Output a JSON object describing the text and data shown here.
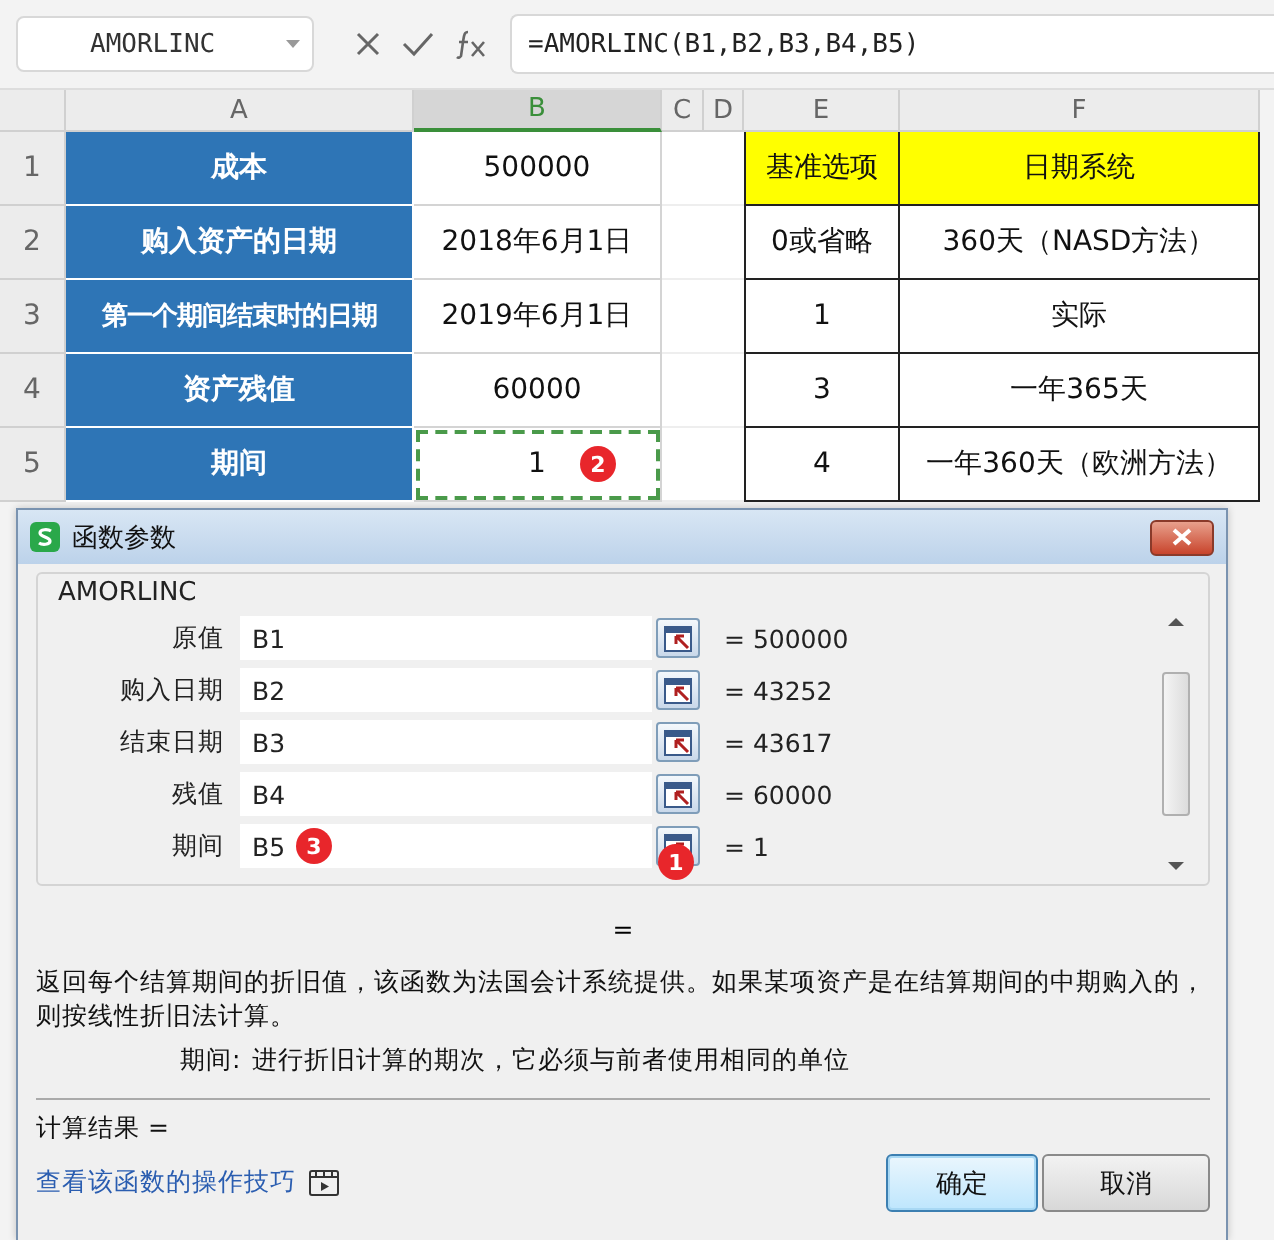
{
  "formula_bar": {
    "name_box": "AMORLINC",
    "formula": "=AMORLINC(B1,B2,B3,B4,B5)"
  },
  "columns": [
    {
      "label": "A",
      "selected": false
    },
    {
      "label": "B",
      "selected": true
    },
    {
      "label": "C",
      "selected": false
    },
    {
      "label": "D",
      "selected": false
    },
    {
      "label": "E",
      "selected": false
    },
    {
      "label": "F",
      "selected": false
    }
  ],
  "rows": [
    {
      "number": "1",
      "cells": [
        {
          "kind": "label",
          "text": "成本",
          "selected": false
        },
        {
          "kind": "value",
          "text": "500000",
          "selected": false
        },
        {
          "kind": "empty"
        },
        {
          "kind": "empty"
        },
        {
          "kind": "header",
          "text": "基准选项",
          "selected": false
        },
        {
          "kind": "header",
          "text": "日期系统",
          "selected": false
        }
      ]
    },
    {
      "number": "2",
      "cells": [
        {
          "kind": "label",
          "text": "购入资产的日期",
          "selected": false
        },
        {
          "kind": "value",
          "text": "2018年6月1日",
          "selected": false
        },
        {
          "kind": "empty"
        },
        {
          "kind": "empty"
        },
        {
          "kind": "value",
          "text": "0或省略",
          "selected": false
        },
        {
          "kind": "value",
          "text": "360天（NASD方法）",
          "selected": false
        }
      ]
    },
    {
      "number": "3",
      "cells": [
        {
          "kind": "label",
          "text": "第一个期间结束时的日期",
          "selected": false
        },
        {
          "kind": "value",
          "text": "2019年6月1日",
          "selected": false
        },
        {
          "kind": "empty"
        },
        {
          "kind": "empty"
        },
        {
          "kind": "value",
          "text": "1",
          "selected": false
        },
        {
          "kind": "value",
          "text": "实际",
          "selected": false
        }
      ]
    },
    {
      "number": "4",
      "cells": [
        {
          "kind": "label",
          "text": "资产残值",
          "selected": false
        },
        {
          "kind": "value",
          "text": "60000",
          "selected": false
        },
        {
          "kind": "empty"
        },
        {
          "kind": "empty"
        },
        {
          "kind": "value",
          "text": "3",
          "selected": false
        },
        {
          "kind": "value",
          "text": "一年365天",
          "selected": false
        }
      ]
    },
    {
      "number": "5",
      "cells": [
        {
          "kind": "label",
          "text": "期间",
          "selected": false
        },
        {
          "kind": "value",
          "text": "1",
          "selected": true,
          "badge": "2"
        },
        {
          "kind": "empty"
        },
        {
          "kind": "empty"
        },
        {
          "kind": "value",
          "text": "4",
          "selected": false
        },
        {
          "kind": "value",
          "text": "一年360天（欧洲方法）",
          "selected": false
        }
      ]
    }
  ],
  "dialog": {
    "title": "函数参数",
    "function_name": "AMORLINC",
    "arguments": [
      {
        "label": "原值",
        "value": "B1",
        "result": "= 500000"
      },
      {
        "label": "购入日期",
        "value": "B2",
        "result": "= 43252"
      },
      {
        "label": "结束日期",
        "value": "B3",
        "result": "= 43617"
      },
      {
        "label": "残值",
        "value": "B4",
        "result": "= 60000"
      },
      {
        "label": "期间",
        "value": "B5",
        "result": "= 1",
        "field_badge": "3",
        "button_badge": "1"
      }
    ],
    "formula_result": "=",
    "description": "返回每个结算期间的折旧值，该函数为法国会计系统提供。如果某项资产是在结算期间的中期购入的，则按线性折旧法计算。",
    "argument_help": {
      "name": "期间:",
      "text": "进行折旧计算的期次，它必须与前者使用相同的单位"
    },
    "result_label": "计算结果 =",
    "help_link": "查看该函数的操作技巧",
    "buttons": [
      {
        "label": "确定",
        "default": true
      },
      {
        "label": "取消",
        "default": false
      }
    ]
  }
}
